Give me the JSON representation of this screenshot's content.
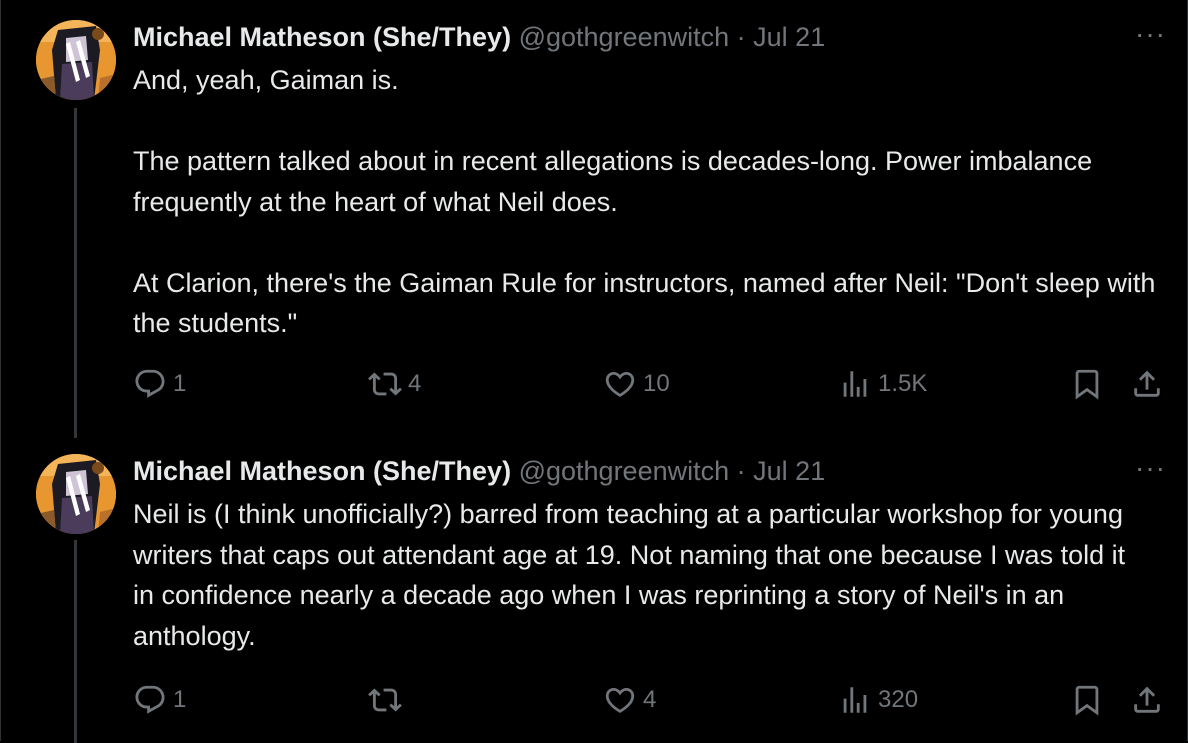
{
  "tweets": [
    {
      "author_name": "Michael Matheson (She/They)",
      "handle": "@gothgreenwitch",
      "separator": "·",
      "date": "Jul 21",
      "more_label": "···",
      "paragraphs": [
        "And, yeah, Gaiman is.",
        "The pattern talked about in recent allegations is decades-long. Power imbalance frequently at the heart of what Neil does.",
        "At Clarion, there's the Gaiman Rule for instructors, named after Neil: \"Don't sleep with the students.\""
      ],
      "stats": {
        "replies": "1",
        "reposts": "4",
        "likes": "10",
        "views": "1.5K"
      }
    },
    {
      "author_name": "Michael Matheson (She/They)",
      "handle": "@gothgreenwitch",
      "separator": "·",
      "date": "Jul 21",
      "more_label": "···",
      "paragraphs": [
        "Neil is (I think unofficially?) barred from teaching at a particular workshop for young writers that caps out attendant age at 19. Not naming that one because I was told it in confidence nearly a decade ago when I was reprinting a story of Neil's in an anthology."
      ],
      "stats": {
        "replies": "1",
        "reposts": "",
        "likes": "4",
        "views": "320"
      }
    }
  ],
  "colors": {
    "background": "#000000",
    "text_primary": "#e7e9ea",
    "text_secondary": "#71767b",
    "thread_line": "#333639"
  },
  "icons": [
    "reply-icon",
    "repost-icon",
    "like-icon",
    "views-icon",
    "bookmark-icon",
    "share-icon",
    "more-icon"
  ]
}
